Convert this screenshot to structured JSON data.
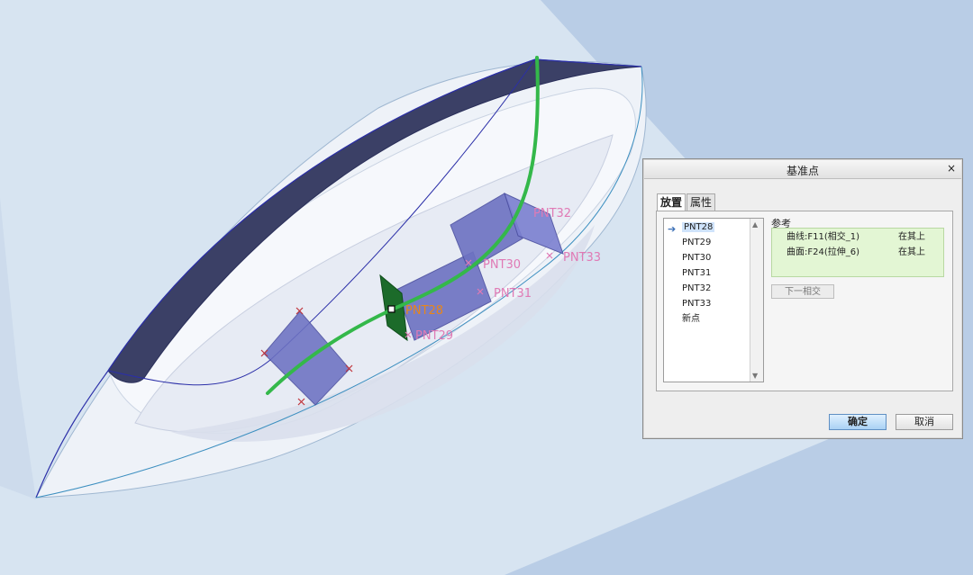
{
  "viewport": {
    "points": [
      {
        "label": "PNT28",
        "color": "#e98618"
      },
      {
        "label": "PNT29",
        "color": "#e07ab5"
      },
      {
        "label": "PNT30",
        "color": "#e07ab5"
      },
      {
        "label": "PNT31",
        "color": "#e07ab5"
      },
      {
        "label": "PNT32",
        "color": "#e07ab5"
      },
      {
        "label": "PNT33",
        "color": "#e07ab5"
      }
    ],
    "colors": {
      "background": "#b9cde6",
      "plane": "#d7e4f1",
      "dark_surface": "#3b4066",
      "curve": "#34b84a",
      "datum_plane": "#6d72c2"
    }
  },
  "dialog": {
    "title": "基准点",
    "close": "×",
    "tabs": [
      {
        "label": "放置",
        "active": true
      },
      {
        "label": "属性",
        "active": false
      }
    ],
    "list": {
      "items": [
        "PNT28",
        "PNT29",
        "PNT30",
        "PNT31",
        "PNT32",
        "PNT33",
        "新点"
      ],
      "selected": "PNT28"
    },
    "references": {
      "label": "参考",
      "rows": [
        {
          "name": "曲线:F11(相交_1)",
          "type": "在其上"
        },
        {
          "name": "曲面:F24(拉伸_6)",
          "type": "在其上"
        }
      ]
    },
    "next_intersection": "下一相交",
    "ok": "确定",
    "cancel": "取消"
  }
}
